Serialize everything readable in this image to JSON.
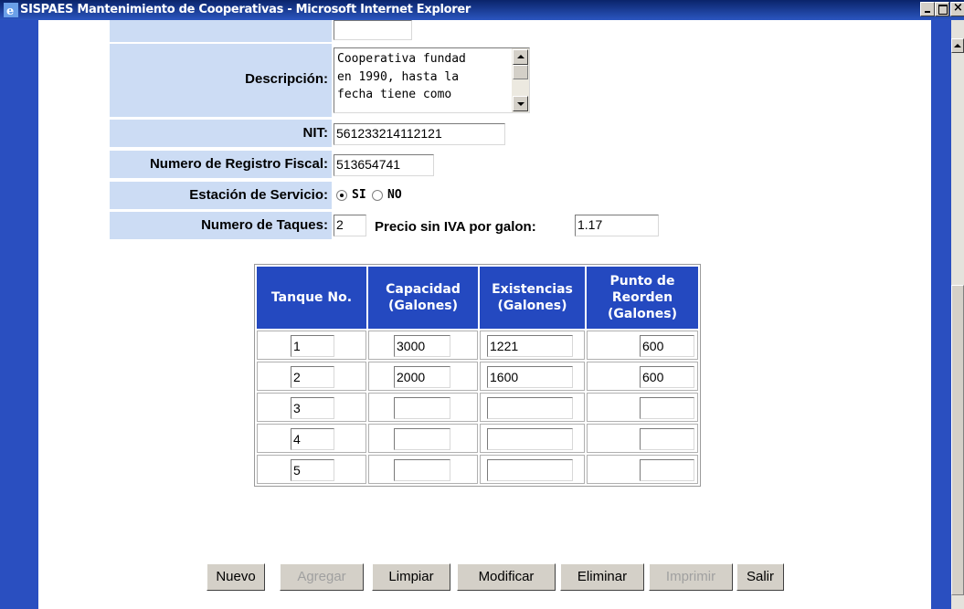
{
  "window": {
    "title": "SISPAES Mantenimiento de Cooperativas - Microsoft Internet Explorer"
  },
  "colors": {
    "title_bar": "#0a246a",
    "page_frame": "#2a4fc0",
    "label_bg": "#ccdcf4",
    "table_header": "#2449c0"
  },
  "form": {
    "descripcion": {
      "label": "Descripción:",
      "value": "Cooperativa fundad\nen 1990, hasta la\nfecha tiene como"
    },
    "nit": {
      "label": "NIT:",
      "value": "561233214112121"
    },
    "registro_fiscal": {
      "label": "Numero de Registro Fiscal:",
      "value": "513654741"
    },
    "estacion_servicio": {
      "label": "Estación de Servicio:",
      "option_si": "SI",
      "option_no": "NO",
      "selected": "SI"
    },
    "numero_tanques": {
      "label": "Numero de Taques:",
      "value": "2"
    },
    "precio_sin_iva": {
      "label": "Precio sin IVA por galon:",
      "value": "1.17"
    }
  },
  "tanks_table": {
    "headers": [
      "Tanque No.",
      "Capacidad (Galones)",
      "Existencias (Galones)",
      "Punto de Reorden (Galones)"
    ],
    "rows": [
      {
        "tanque": "1",
        "capacidad": "3000",
        "existencias": "1221",
        "reorden": "600"
      },
      {
        "tanque": "2",
        "capacidad": "2000",
        "existencias": "1600",
        "reorden": "600"
      },
      {
        "tanque": "3",
        "capacidad": "",
        "existencias": "",
        "reorden": ""
      },
      {
        "tanque": "4",
        "capacidad": "",
        "existencias": "",
        "reorden": ""
      },
      {
        "tanque": "5",
        "capacidad": "",
        "existencias": "",
        "reorden": ""
      }
    ]
  },
  "buttons": {
    "nuevo": "Nuevo",
    "agregar": "Agregar",
    "limpiar": "Limpiar",
    "modificar": "Modificar",
    "eliminar": "Eliminar",
    "imprimir": "Imprimir",
    "salir": "Salir"
  }
}
